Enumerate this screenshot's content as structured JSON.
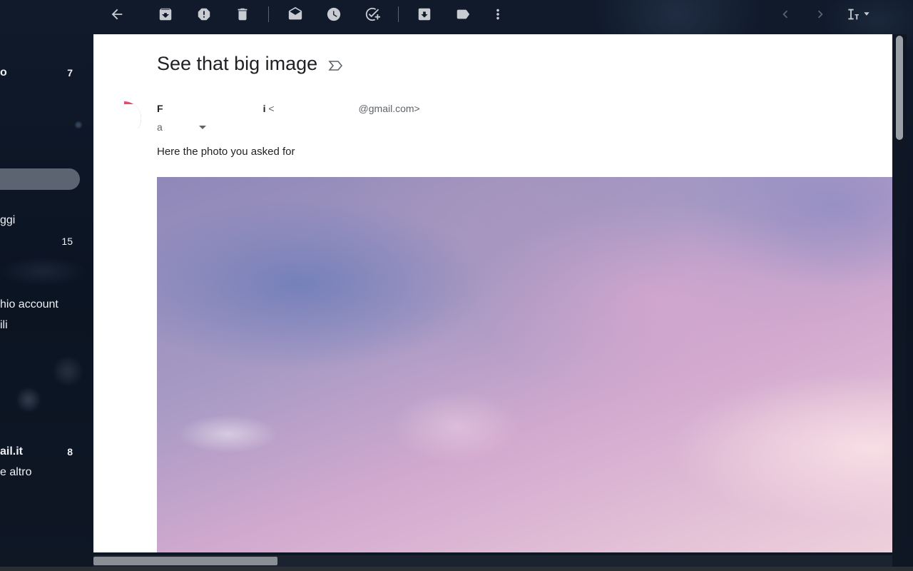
{
  "toolbar": {
    "icons": [
      "back-arrow-icon",
      "archive-icon",
      "report-spam-icon",
      "delete-icon",
      "mark-unread-icon",
      "snooze-icon",
      "add-to-tasks-icon",
      "move-to-icon",
      "label-icon",
      "more-vert-icon",
      "prev-icon",
      "next-icon",
      "input-tools-icon"
    ]
  },
  "sidebar": {
    "items": [
      {
        "label": "o",
        "count": "7"
      },
      {
        "label": "ggi",
        "count": ""
      },
      {
        "label": "",
        "count": "15"
      },
      {
        "label": "hio account",
        "count": ""
      },
      {
        "label": "ili",
        "count": ""
      },
      {
        "label": "ail.it",
        "count": "8"
      },
      {
        "label": "e altro",
        "count": ""
      }
    ]
  },
  "message": {
    "subject": "See that big image",
    "sender_name_start": "F",
    "sender_name_end": "i",
    "sender_email_open": "<",
    "sender_email_domain": "@gmail.com>",
    "to_prefix": "a",
    "body": "Here the photo you asked for"
  },
  "colors": {
    "background": "#0d1626",
    "pane": "#ffffff",
    "sidebar_selected": "#6b7280"
  }
}
